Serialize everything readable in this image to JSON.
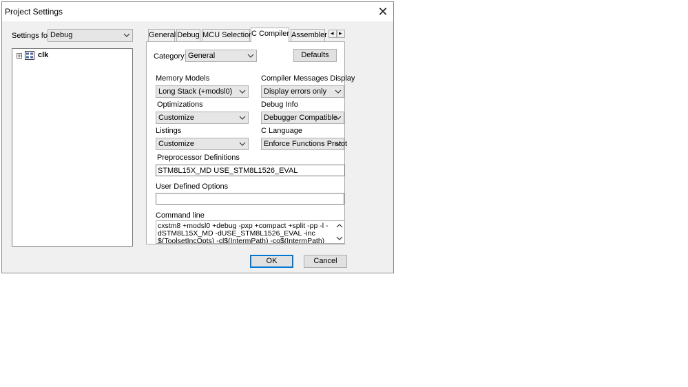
{
  "window": {
    "title": "Project Settings",
    "close_glyph": "✕"
  },
  "settings_for": {
    "label": "Settings for:",
    "value": "Debug"
  },
  "tree": {
    "expander": "⊞",
    "item_label": "clk",
    "item_icon": "project-icon"
  },
  "tabs": [
    {
      "label": "General"
    },
    {
      "label": "Debug"
    },
    {
      "label": "MCU Selection"
    },
    {
      "label": "C Compiler",
      "active": true
    },
    {
      "label": "Assembler"
    }
  ],
  "tab_scroll": {
    "left": "◂",
    "right": "▸"
  },
  "category": {
    "label": "Category:",
    "value": "General"
  },
  "defaults_button": "Defaults",
  "memory_models": {
    "label": "Memory Models",
    "value": "Long Stack (+modsl0)"
  },
  "compiler_messages": {
    "label": "Compiler Messages Display",
    "value": "Display errors only"
  },
  "optimizations": {
    "label": "Optimizations",
    "value": "Customize"
  },
  "debug_info": {
    "label": "Debug Info",
    "value": "Debugger Compatible"
  },
  "listings": {
    "label": "Listings",
    "value": "Customize"
  },
  "c_language": {
    "label": "C Language",
    "value": "Enforce Functions Protot"
  },
  "preprocessor": {
    "label": "Preprocessor Definitions",
    "value": "STM8L15X_MD USE_STM8L1526_EVAL"
  },
  "user_options": {
    "label": "User Defined Options",
    "value": ""
  },
  "command_line": {
    "label": "Command line",
    "lines": [
      "cxstm8 +modsl0 +debug -pxp +compact +split -pp -l -",
      "dSTM8L15X_MD -dUSE_STM8L1526_EVAL -inc",
      "$(ToolsetIncOpts) -cl$(IntermPath) -co$(IntermPath)"
    ]
  },
  "ok_button": "OK",
  "cancel_button": "Cancel",
  "colors": {
    "accent": "#0078d7",
    "dialog_bg": "#f0f0f0"
  }
}
